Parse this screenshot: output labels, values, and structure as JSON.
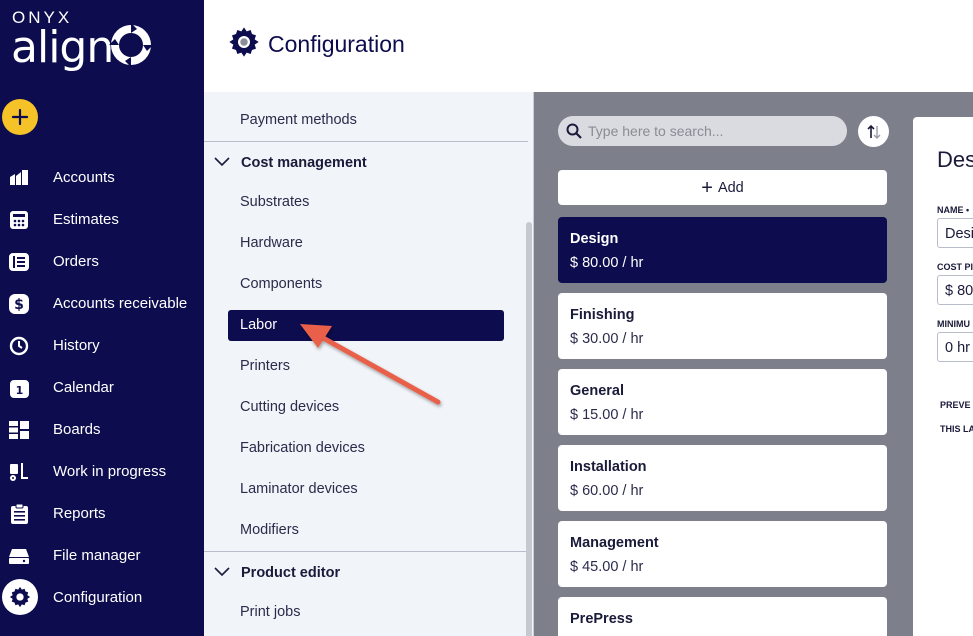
{
  "brand": {
    "top": "ONYX",
    "name": "align"
  },
  "sidebar": {
    "items": [
      {
        "label": "Accounts",
        "icon": "accounts-icon"
      },
      {
        "label": "Estimates",
        "icon": "calculator-icon"
      },
      {
        "label": "Orders",
        "icon": "orders-icon"
      },
      {
        "label": "Accounts receivable",
        "icon": "dollar-icon"
      },
      {
        "label": "History",
        "icon": "history-icon"
      },
      {
        "label": "Calendar",
        "icon": "calendar-icon"
      },
      {
        "label": "Boards",
        "icon": "boards-icon"
      },
      {
        "label": "Work in progress",
        "icon": "forklift-icon"
      },
      {
        "label": "Reports",
        "icon": "clipboard-icon"
      },
      {
        "label": "File manager",
        "icon": "drive-icon"
      },
      {
        "label": "Configuration",
        "icon": "gear-icon"
      }
    ],
    "calendar_day": "1"
  },
  "header": {
    "title": "Configuration"
  },
  "menu": {
    "top_item": "Payment methods",
    "groups": [
      {
        "label": "Cost management",
        "items": [
          "Substrates",
          "Hardware",
          "Components",
          "Labor",
          "Printers",
          "Cutting devices",
          "Fabrication devices",
          "Laminator devices",
          "Modifiers"
        ]
      },
      {
        "label": "Product editor",
        "items": [
          "Print jobs"
        ]
      }
    ],
    "active_item": "Labor"
  },
  "list": {
    "search_placeholder": "Type here to search...",
    "add_label": "Add",
    "cards": [
      {
        "name": "Design",
        "value": "$ 80.00 / hr",
        "selected": true
      },
      {
        "name": "Finishing",
        "value": "$ 30.00 / hr"
      },
      {
        "name": "General",
        "value": "$ 15.00 / hr"
      },
      {
        "name": "Installation",
        "value": "$ 60.00 / hr"
      },
      {
        "name": "Management",
        "value": "$ 45.00 / hr"
      },
      {
        "name": "PrePress",
        "value": ""
      }
    ]
  },
  "detail": {
    "title": "Des",
    "fields": [
      {
        "label": "NAME •",
        "value": "Desi"
      },
      {
        "label": "COST PI",
        "value": "$ 80"
      },
      {
        "label": "MINIMU",
        "value": "0 hr"
      }
    ],
    "note_1": "PREVE",
    "note_2": "THIS LA"
  },
  "colors": {
    "sidebar": "#0c0c4e",
    "accent": "#f5c227",
    "arrow": "#e8604a",
    "list_bg": "#7d808a"
  }
}
